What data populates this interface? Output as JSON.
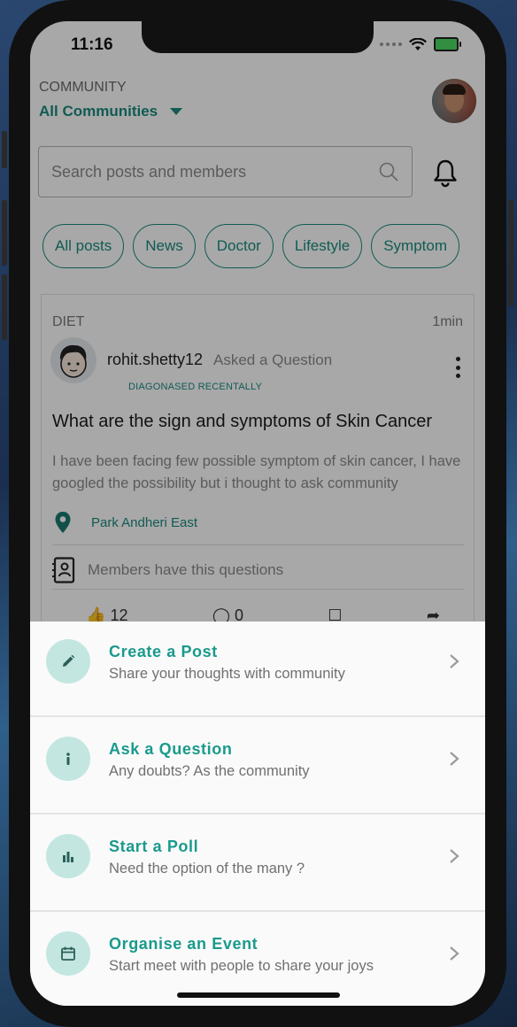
{
  "status_bar": {
    "time": "11:16"
  },
  "header": {
    "community_label": "COMMUNITY",
    "community_selected": "All Communities"
  },
  "search": {
    "placeholder": "Search posts and members"
  },
  "filters": [
    "All posts",
    "News",
    "Doctor",
    "Lifestyle",
    "Symptom"
  ],
  "post": {
    "tag": "DIET",
    "time": "1min",
    "author": "rohit.shetty12",
    "action": "Asked a Question",
    "badge": "DIAGONASED RECENTALLY",
    "title": "What are the sign and symptoms of Skin Cancer",
    "body": "I have been facing few possible symptom of skin cancer, I have googled the possibility but i thought to ask community",
    "location": "Park Andheri East",
    "members_text": "Members have this questions",
    "likes": "12",
    "comments": "0"
  },
  "sheet": {
    "items": [
      {
        "title": "Create a Post",
        "subtitle": "Share your thoughts with community",
        "icon": "pencil-icon"
      },
      {
        "title": "Ask a Question",
        "subtitle": "Any doubts? As the community",
        "icon": "info-icon"
      },
      {
        "title": "Start a Poll",
        "subtitle": "Need the option of the many ?",
        "icon": "bar-chart-icon"
      },
      {
        "title": "Organise an Event",
        "subtitle": "Start meet with people to share your joys",
        "icon": "calendar-icon"
      }
    ]
  },
  "colors": {
    "accent": "#1a8b7f",
    "sheet_icon_bg": "#c3e6e1",
    "overlay": "rgba(0,0,0,0.34)"
  }
}
